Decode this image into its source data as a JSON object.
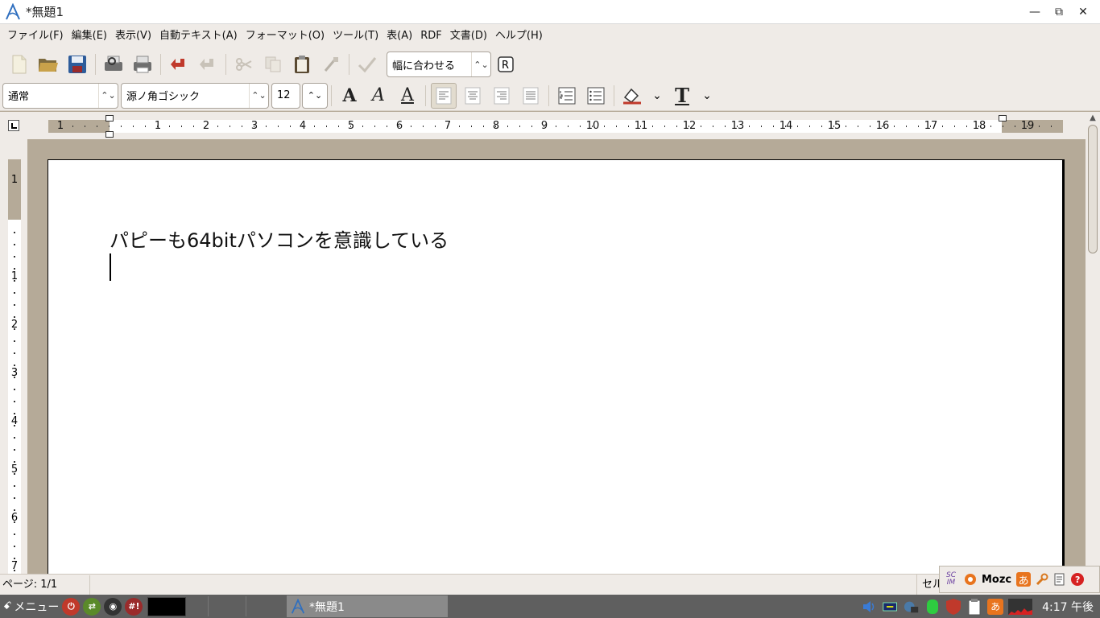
{
  "window": {
    "title": "*無題1",
    "minimize_glyph": "—",
    "maximize_glyph": "⧉",
    "close_glyph": "✕"
  },
  "menubar": [
    {
      "label": "ファイル(F)"
    },
    {
      "label": "編集(E)"
    },
    {
      "label": "表示(V)"
    },
    {
      "label": "自動テキスト(A)"
    },
    {
      "label": "フォーマット(O)"
    },
    {
      "label": "ツール(T)"
    },
    {
      "label": "表(A)"
    },
    {
      "label": "RDF"
    },
    {
      "label": "文書(D)"
    },
    {
      "label": "ヘルプ(H)"
    }
  ],
  "toolbar": {
    "zoom_value": "幅に合わせる",
    "icons": [
      "new-document-icon",
      "open-folder-icon",
      "save-icon",
      "print-preview-icon",
      "print-icon",
      "undo-icon",
      "redo-icon",
      "cut-icon",
      "copy-icon",
      "paste-icon",
      "format-painter-icon",
      "spellcheck-icon",
      "rdf-icon"
    ]
  },
  "format_toolbar": {
    "style_value": "通常",
    "font_value": "源ノ角ゴシック",
    "size_value": "12",
    "bold_glyph": "A",
    "italic_glyph": "A",
    "underline_glyph": "A",
    "text_color_glyph": "T"
  },
  "ruler": {
    "numbers": [
      "1",
      "1",
      "2",
      "3",
      "4",
      "5",
      "6",
      "7",
      "8",
      "9",
      "10",
      "11",
      "12",
      "13",
      "14",
      "15",
      "16",
      "17",
      "18",
      "19"
    ],
    "vertical_numbers": [
      "1",
      "1",
      "2",
      "3",
      "4",
      "5",
      "6",
      "7"
    ]
  },
  "document": {
    "text": "パピーも64bitパソコンを意識している"
  },
  "statusbar": {
    "page_info": "ページ: 1/1",
    "selection_info": "セル"
  },
  "ime": {
    "scim_label": "SC IM",
    "mode_glyph": "あ",
    "engine": "Mozc",
    "help_glyph": "?"
  },
  "taskbar": {
    "menu_label": "メニュー",
    "hash_label": "#!",
    "task_title": "*無題1",
    "ime_glyph": "あ",
    "clock": "4:17 午後"
  },
  "colors": {
    "chrome": "#efebe7",
    "canvas": "#b5aa98",
    "taskbar": "#5f5f5f"
  }
}
